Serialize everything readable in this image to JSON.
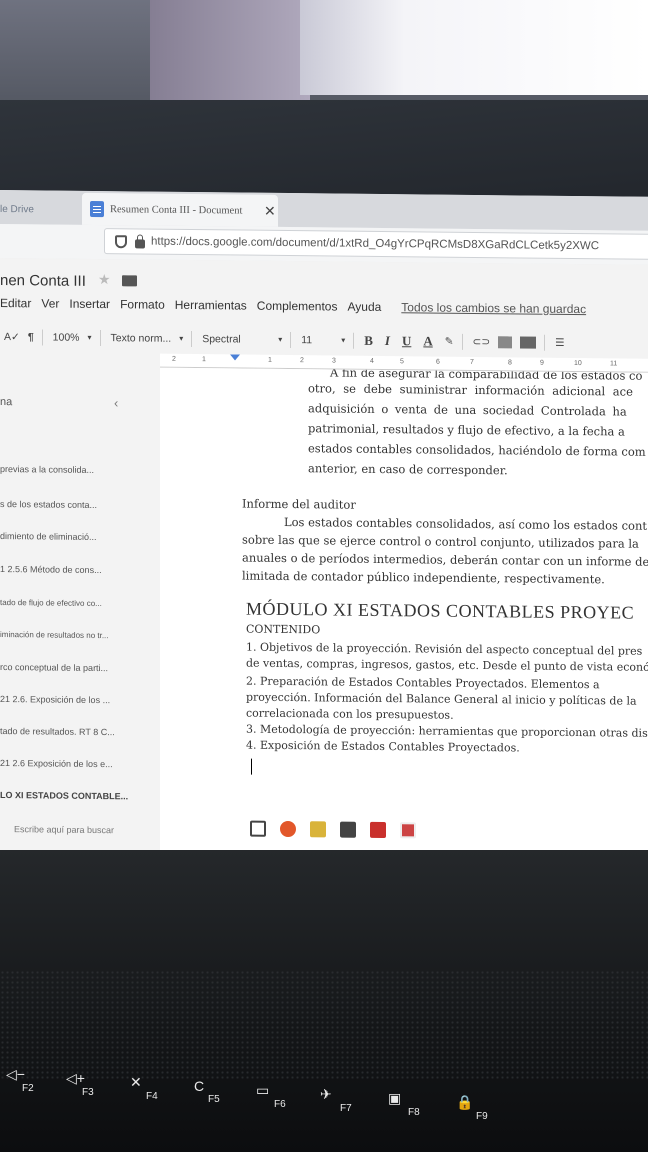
{
  "browser": {
    "ghost_tab": "le Drive",
    "active_tab_title": "Resumen Conta III - Document",
    "close_glyph": "✕",
    "url": "https://docs.google.com/document/d/1xtRd_O4gYrCPqRCMsD8XGaRdCLCetk5y2XWC"
  },
  "docs": {
    "title": "nen Conta III",
    "menu": [
      "Editar",
      "Ver",
      "Insertar",
      "Formato",
      "Herramientas",
      "Complementos",
      "Ayuda"
    ],
    "saved_status": "Todos los cambios se han guardac",
    "toolbar": {
      "zoom": "100%",
      "style": "Texto norm...",
      "font": "Spectral",
      "size": "11",
      "bold": "B",
      "italic": "I",
      "underline": "U",
      "text_color": "A"
    },
    "ruler_numbers": [
      "2",
      "1",
      "1",
      "2",
      "3",
      "4",
      "5",
      "6",
      "7",
      "8",
      "9",
      "10",
      "11"
    ]
  },
  "outline": {
    "header": "na",
    "items": [
      "previas a la consolida...",
      "s de los estados conta...",
      "dimiento de eliminació...",
      "1 2.5.6 Método de cons...",
      "tado de flujo de efectivo co...",
      "iminación de resultados no tr...",
      "rco conceptual de la parti...",
      "21 2.6. Exposición de los ...",
      "tado de resultados. RT 8 C...",
      "21 2.6 Exposición de los e...",
      "LO XI ESTADOS CONTABLE..."
    ],
    "search_placeholder": "Escribe aquí para buscar"
  },
  "document": {
    "lines_top": [
      "A fin de asegurar la comparabilidad de los estados co",
      "otro, se debe suministrar información adicional ace",
      "adquisición o venta de una sociedad Controlada ha",
      "patrimonial, resultados y flujo de efectivo, a la fecha a",
      "estados contables consolidados, haciéndolo de forma com",
      "anterior, en caso de corresponder."
    ],
    "section_title": "Informe del auditor",
    "section_lines": [
      "Los estados contables consolidados, así como los estados cont",
      "sobre las que se ejerce control o control conjunto, utilizados para la",
      "anuales o de períodos intermedios, deberán contar con un informe de",
      "limitada de contador público independiente, respectivamente."
    ],
    "module_title": "MÓDULO XI ESTADOS CONTABLES PROYEC",
    "contenido": "CONTENIDO",
    "module_lines": [
      "1. Objetivos de la proyección. Revisión del aspecto conceptual del pres",
      "de ventas, compras, ingresos, gastos, etc. Desde el punto de vista econó",
      "2.  Preparación  de  Estados  Contables  Proyectados.  Elementos  a",
      "proyección. Información del Balance General al inicio y políticas de la",
      "correlacionada con los presupuestos.",
      "3. Metodología de proyección: herramientas que proporcionan otras dis",
      "4. Exposición de Estados Contables Proyectados."
    ]
  },
  "keyboard": {
    "keys": [
      {
        "sym": "◁−",
        "label": "F2"
      },
      {
        "sym": "◁+",
        "label": "F3"
      },
      {
        "sym": "✕",
        "label": "F4"
      },
      {
        "sym": "C",
        "label": "F5"
      },
      {
        "sym": "▭",
        "label": "F6"
      },
      {
        "sym": "✈",
        "label": "F7"
      },
      {
        "sym": "▣",
        "label": "F8"
      },
      {
        "sym": "🔒",
        "label": "F9"
      }
    ]
  }
}
